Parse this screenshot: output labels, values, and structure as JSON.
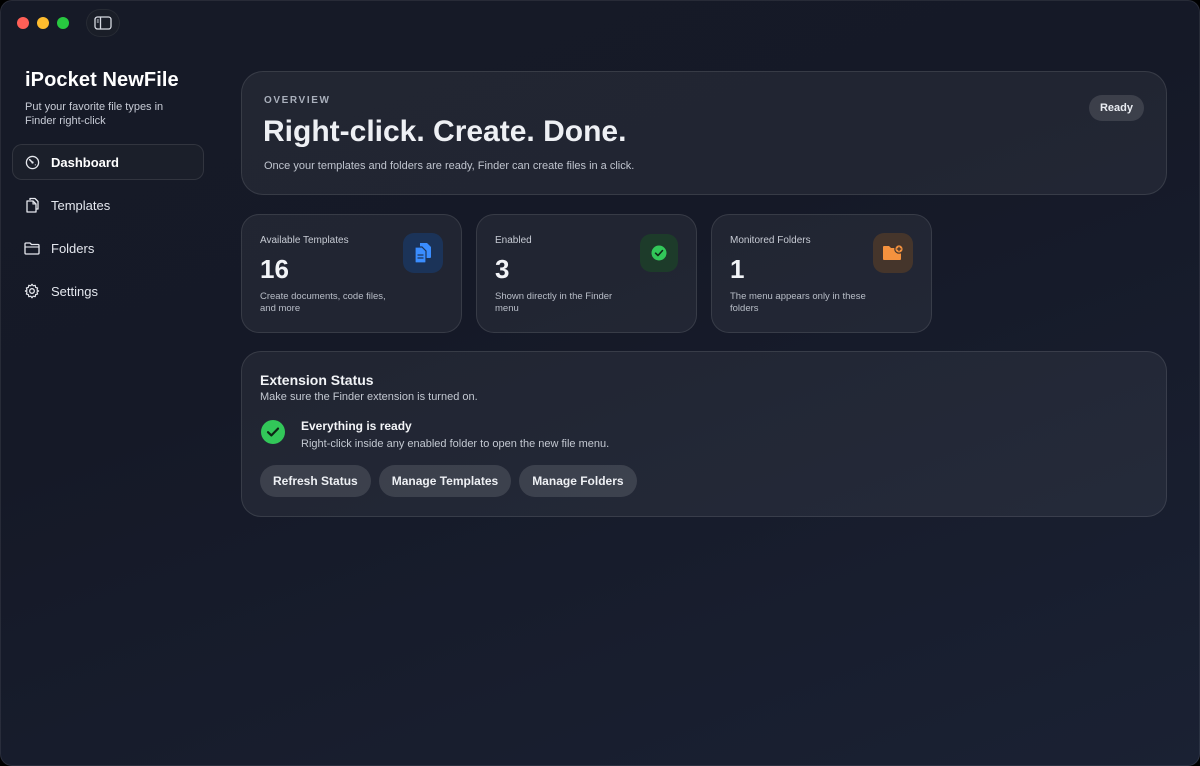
{
  "app": {
    "title": "iPocket NewFile",
    "subtitle": "Put your favorite file types in Finder right-click"
  },
  "sidebar": {
    "items": [
      {
        "label": "Dashboard",
        "icon": "gauge-icon",
        "active": true
      },
      {
        "label": "Templates",
        "icon": "documents-icon",
        "active": false
      },
      {
        "label": "Folders",
        "icon": "folder-icon",
        "active": false
      },
      {
        "label": "Settings",
        "icon": "gear-icon",
        "active": false
      }
    ]
  },
  "overview": {
    "label": "OVERVIEW",
    "headline": "Right-click. Create. Done.",
    "description": "Once your templates and folders are ready, Finder can create files in a click.",
    "badge": "Ready"
  },
  "stats": [
    {
      "label": "Available Templates",
      "value": "16",
      "description": "Create documents, code files, and more",
      "icon": "documents-icon",
      "accent": "#3a8dff"
    },
    {
      "label": "Enabled",
      "value": "3",
      "description": "Shown directly in the Finder menu",
      "icon": "checkmark-circle-icon",
      "accent": "#32c759"
    },
    {
      "label": "Monitored Folders",
      "value": "1",
      "description": "The menu appears only in these folders",
      "icon": "folder-add-icon",
      "accent": "#f5923e"
    }
  ],
  "extension_status": {
    "title": "Extension Status",
    "description": "Make sure the Finder extension is turned on.",
    "status_title": "Everything is ready",
    "status_description": "Right-click inside any enabled folder to open the new file menu.",
    "buttons": [
      "Refresh Status",
      "Manage Templates",
      "Manage Folders"
    ]
  },
  "colors": {
    "success": "#32c759",
    "templates_accent": "#3a8dff",
    "folders_accent": "#f5923e"
  }
}
